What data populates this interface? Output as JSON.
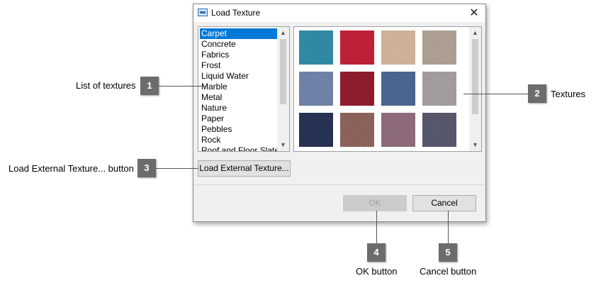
{
  "dialog": {
    "title": "Load Texture",
    "close_glyph": "✕",
    "list": {
      "items": [
        "Carpet",
        "Concrete",
        "Fabrics",
        "Frost",
        "Liquid Water",
        "Marble",
        "Metal",
        "Nature",
        "Paper",
        "Pebbles",
        "Rock",
        "Roof and Floor Slate"
      ],
      "selected": "Carpet"
    },
    "scroll_up_glyph": "▲",
    "scroll_down_glyph": "▼",
    "textures": [
      {
        "name": "carpet-teal",
        "color": "#2a8aa6"
      },
      {
        "name": "carpet-red",
        "color": "#c21a33"
      },
      {
        "name": "carpet-beige",
        "color": "#d4b79a"
      },
      {
        "name": "carpet-taupe",
        "color": "#b0a294"
      },
      {
        "name": "carpet-slate-blue",
        "color": "#6d82ab"
      },
      {
        "name": "carpet-burgundy",
        "color": "#8f1428"
      },
      {
        "name": "carpet-steel-blue",
        "color": "#46648f"
      },
      {
        "name": "carpet-grey-mauve",
        "color": "#a59ea2"
      },
      {
        "name": "carpet-navy",
        "color": "#202c50"
      },
      {
        "name": "carpet-herringbone-rust",
        "color": "#8c6058"
      },
      {
        "name": "carpet-herringbone-mauve",
        "color": "#8e6a7a"
      },
      {
        "name": "carpet-multicolor",
        "color": "#54546a"
      }
    ],
    "buttons": {
      "load_external": "Load External Texture...",
      "ok": "OK",
      "cancel": "Cancel"
    }
  },
  "callouts": [
    {
      "number": "1",
      "label": "List of textures"
    },
    {
      "number": "2",
      "label": "Textures"
    },
    {
      "number": "3",
      "label": "Load External Texture... button"
    },
    {
      "number": "4",
      "label": "OK button"
    },
    {
      "number": "5",
      "label": "Cancel button"
    }
  ]
}
